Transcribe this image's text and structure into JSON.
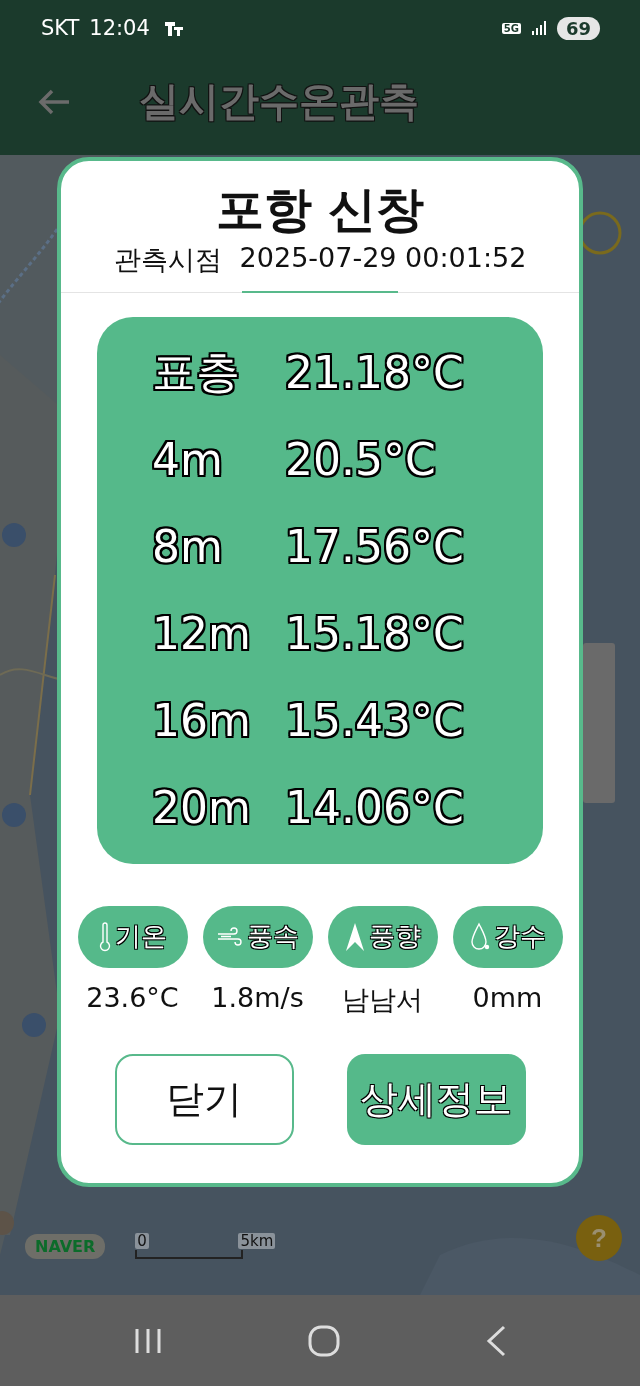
{
  "status_bar": {
    "carrier": "SKT",
    "time": "12:04",
    "network": "5G",
    "battery": "69"
  },
  "header": {
    "title": "실시간수온관측"
  },
  "map": {
    "logo": "NAVER",
    "scale_start": "0",
    "scale_end": "5km",
    "help": "?"
  },
  "dialog": {
    "station": "포항 신창",
    "observed_label": "관측시점",
    "observed_time": "2025-07-29 00:01:52",
    "depths": [
      {
        "depth": "표층",
        "temperature": "21.18°C"
      },
      {
        "depth": "4m",
        "temperature": "20.5°C"
      },
      {
        "depth": "8m",
        "temperature": "17.56°C"
      },
      {
        "depth": "12m",
        "temperature": "15.18°C"
      },
      {
        "depth": "16m",
        "temperature": "15.43°C"
      },
      {
        "depth": "20m",
        "temperature": "14.06°C"
      }
    ],
    "weather": [
      {
        "kind": "temperature",
        "label": "기온",
        "value": "23.6°C"
      },
      {
        "kind": "wind_speed",
        "label": "풍속",
        "value": "1.8m/s"
      },
      {
        "kind": "wind_direction",
        "label": "풍향",
        "value": "남남서"
      },
      {
        "kind": "rain",
        "label": "강수",
        "value": "0mm"
      }
    ],
    "buttons": [
      {
        "kind": "outline",
        "label": "닫기"
      },
      {
        "kind": "filled",
        "label": "상세정보"
      }
    ]
  }
}
